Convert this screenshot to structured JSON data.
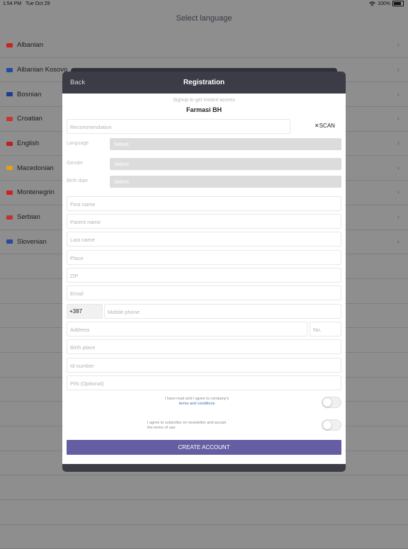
{
  "status_bar": {
    "time": "1:54 PM",
    "date": "Tue Oct 29",
    "battery": "100%"
  },
  "background": {
    "title": "Select language",
    "languages": [
      {
        "name": "Albanian",
        "flag_color": "#c22"
      },
      {
        "name": "Albanian Kosovo",
        "flag_color": "#244aa5"
      },
      {
        "name": "Bosnian",
        "flag_color": "#1f3d8f"
      },
      {
        "name": "Croatian",
        "flag_color": "#c33"
      },
      {
        "name": "English",
        "flag_color": "#b22"
      },
      {
        "name": "Macedonian",
        "flag_color": "#e0a01c"
      },
      {
        "name": "Montenegrin",
        "flag_color": "#c22"
      },
      {
        "name": "Serbian",
        "flag_color": "#b33"
      },
      {
        "name": "Slovenian",
        "flag_color": "#2b4a9b"
      }
    ]
  },
  "modal": {
    "back_label": "Back",
    "title": "Registration",
    "subtitle": "Signup to get instant access",
    "company": "Farmasi BH",
    "recommendation_placeholder": "Recommendation",
    "scan_label": "SCAN",
    "language_label": "Language",
    "language_value": "Select",
    "gender_label": "Gender",
    "gender_value": "Select",
    "birthdate_label": "Birth date",
    "birthdate_value": "Select",
    "first_name_placeholder": "First name",
    "parent_name_placeholder": "Parent name",
    "last_name_placeholder": "Last name",
    "place_placeholder": "Place",
    "zip_placeholder": "ZIP",
    "email_placeholder": "Email",
    "phone_prefix": "+387",
    "mobile_placeholder": "Mobile phone",
    "address_placeholder": "Address",
    "number_placeholder": "No.",
    "birth_place_placeholder": "Birth place",
    "id_number_placeholder": "Id number",
    "pin_placeholder": "PIN (Optional)",
    "terms_text": "I have read and I agree to company's",
    "terms_link": "terms and conditions",
    "newsletter_text": "I agree to subscribe on newsletter and accept the terms of use.",
    "create_label": "CREATE ACCOUNT"
  }
}
